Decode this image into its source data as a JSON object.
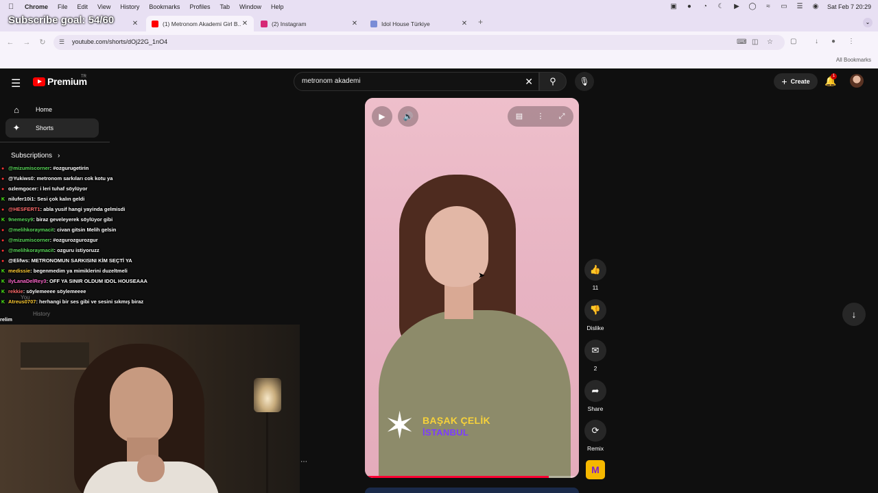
{
  "menubar": {
    "app": "Chrome",
    "items": [
      "File",
      "Edit",
      "View",
      "History",
      "Bookmarks",
      "Profiles",
      "Tab",
      "Window",
      "Help"
    ],
    "clock": "Sat Feb 7  20:29"
  },
  "overlay": {
    "subscribe_goal": "Subscribe goal: 54/60"
  },
  "tabs": [
    {
      "title": "(1) Metronom Akademi Girl B...",
      "favicon_color": "#ff0000"
    },
    {
      "title": "(2) Instagram",
      "favicon_color": "#d62976"
    },
    {
      "title": "Idol House Türkiye",
      "favicon_color": "#7a8cd6"
    }
  ],
  "address": {
    "url": "youtube.com/shorts/dOj22G_1nO4"
  },
  "bookmarks": {
    "all_label": "All Bookmarks"
  },
  "youtube": {
    "brand": "Premium",
    "brand_country": "TR",
    "search_query": "metronom akademi",
    "create_label": "Create",
    "notification_count": "1",
    "sidebar": {
      "items": [
        {
          "label": "Home",
          "icon": "home-icon"
        },
        {
          "label": "Shorts",
          "icon": "shorts-icon"
        }
      ],
      "subscriptions_label": "Subscriptions"
    },
    "sidebar_behind": {
      "you": "You",
      "history": "History"
    },
    "short": {
      "brand_line1": "BAŞAK ÇELİK",
      "brand_line2": "İSTANBUL",
      "progress": 0.86
    },
    "actions": {
      "likes": "11",
      "dislike": "Dislike",
      "comments": "2",
      "share": "Share",
      "remix": "Remix"
    }
  },
  "chat": [
    {
      "platform": "youtube",
      "user": "@mizumiscorner",
      "color": "#5ad85a",
      "msg": ": #ozgurugetirin"
    },
    {
      "platform": "youtube",
      "user": "@Yukiws0",
      "color": "#ffffff",
      "msg": ": metronom sarkıları cok kotu ya"
    },
    {
      "platform": "youtube",
      "user": "ozlemgocer",
      "color": "#ffffff",
      "msg": ": i leri tuhaf söylüyor"
    },
    {
      "platform": "kick",
      "user": "nilufer10i1",
      "color": "#ffffff",
      "msg": ": Sesi çok kalın geldi"
    },
    {
      "platform": "youtube",
      "user": "@HESFERT1",
      "color": "#ff6b6b",
      "msg": ": abla yusif hangi yayinda gelmisdi"
    },
    {
      "platform": "kick",
      "user": "9nemesy9",
      "color": "#5ad85a",
      "msg": ": biraz geveleyerek söylüyor gibi"
    },
    {
      "platform": "youtube",
      "user": "@melihkoraymacit",
      "color": "#5ad85a",
      "msg": ": civan gitsin Melih gelsin"
    },
    {
      "platform": "youtube",
      "user": "@mizumiscorner",
      "color": "#5ad85a",
      "msg": ": #ozgurozgurozgur"
    },
    {
      "platform": "youtube",
      "user": "@melihkoraymacit",
      "color": "#5ad85a",
      "msg": ": ozguru istiyoruzz"
    },
    {
      "platform": "youtube",
      "user": "@Elifws",
      "color": "#ffffff",
      "msg": ": METRONOMUN SARKISINI KİM SEÇTİ YA"
    },
    {
      "platform": "kick",
      "user": "medissie",
      "color": "#ffcc33",
      "msg": ": begenmedim ya mimiklerini duzeltmeli"
    },
    {
      "platform": "kick",
      "user": "ilyLanaDelRey3",
      "color": "#ff66cc",
      "msg": ": OFF YA SINIR OLDUM IDOL HOUSEAAA"
    },
    {
      "platform": "kick",
      "user": "rekkie",
      "color": "#ff6b6b",
      "msg": ": söylemeeee söylemeeee"
    },
    {
      "platform": "kick",
      "user": "Atreus0707",
      "color": "#ffcc33",
      "msg": ": herhangi bir ses gibi ve sesini sıkmış biraz"
    }
  ],
  "chat_tail": "relim"
}
